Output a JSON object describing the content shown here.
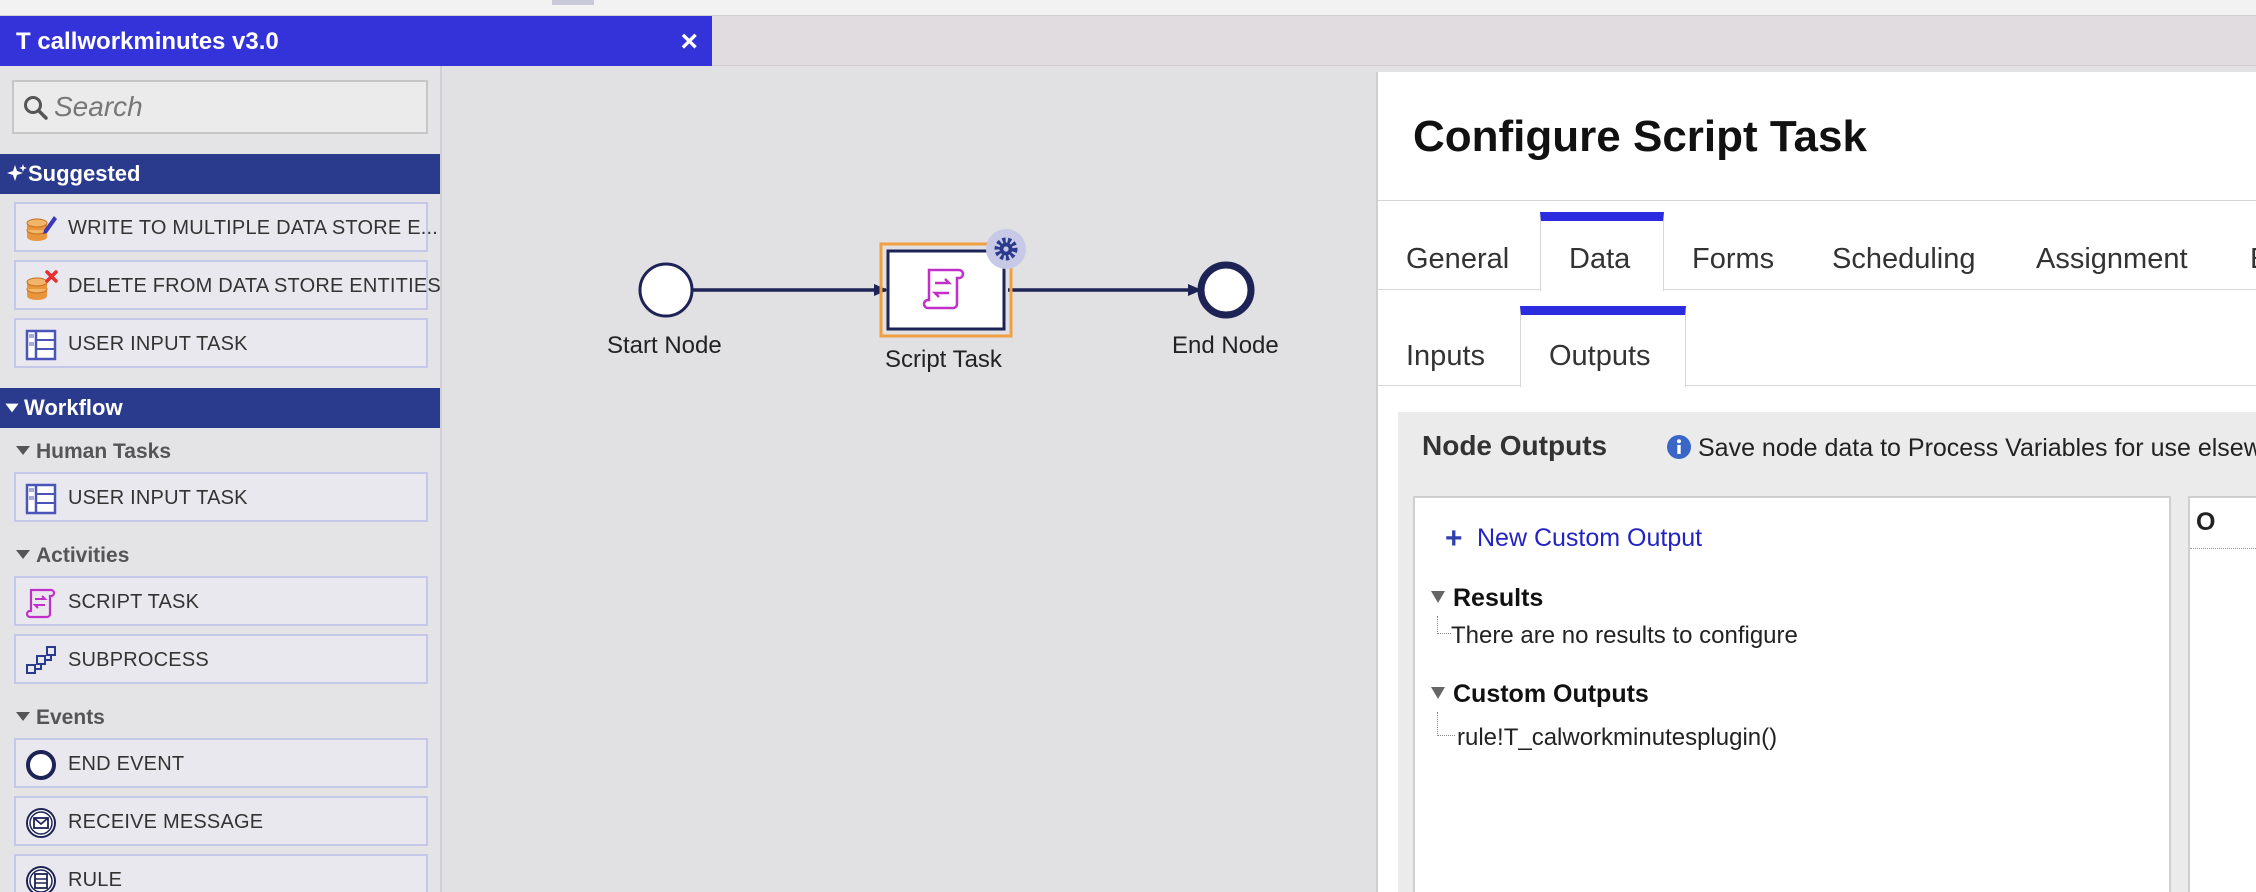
{
  "window": {
    "title": "T callworkminutes v3.0",
    "close_label": "×"
  },
  "palette": {
    "search_placeholder": "Search",
    "suggested": {
      "label": "Suggested",
      "items": [
        {
          "label": "WRITE TO MULTIPLE DATA STORE E...",
          "icon": "write-data-store-icon"
        },
        {
          "label": "DELETE FROM DATA STORE ENTITIES",
          "icon": "delete-data-store-icon"
        },
        {
          "label": "USER INPUT TASK",
          "icon": "user-input-task-icon"
        }
      ]
    },
    "workflow": {
      "label": "Workflow",
      "groups": [
        {
          "label": "Human Tasks",
          "items": [
            {
              "label": "USER INPUT TASK",
              "icon": "user-input-task-icon"
            }
          ]
        },
        {
          "label": "Activities",
          "items": [
            {
              "label": "SCRIPT TASK",
              "icon": "script-task-icon"
            },
            {
              "label": "SUBPROCESS",
              "icon": "subprocess-icon"
            }
          ]
        },
        {
          "label": "Events",
          "items": [
            {
              "label": "END EVENT",
              "icon": "end-event-icon"
            },
            {
              "label": "RECEIVE MESSAGE",
              "icon": "receive-message-icon"
            },
            {
              "label": "RULE",
              "icon": "rule-icon"
            }
          ]
        }
      ]
    }
  },
  "canvas": {
    "nodes": [
      {
        "label": "Start Node",
        "type": "start-event"
      },
      {
        "label": "Script Task",
        "type": "script-task",
        "selected": true
      },
      {
        "label": "End Node",
        "type": "end-event"
      }
    ]
  },
  "config": {
    "title": "Configure Script Task",
    "tabs": [
      "General",
      "Data",
      "Forms",
      "Scheduling",
      "Assignment",
      "E"
    ],
    "active_tab": "Data",
    "subtabs": [
      "Inputs",
      "Outputs"
    ],
    "active_subtab": "Outputs",
    "node_outputs": {
      "heading": "Node Outputs",
      "info": "Save node data to Process Variables for use elsewh",
      "new_custom_output": "New Custom Output",
      "results_label": "Results",
      "results_empty": "There are no results to configure",
      "custom_outputs_label": "Custom Outputs",
      "custom_outputs": [
        "rule!T_calworkminutesplugin()"
      ],
      "right_column_header": "O"
    }
  },
  "colors": {
    "title_bar": "#3333d9",
    "section_header": "#2a3a8c",
    "tab_accent": "#2b2be0",
    "link": "#2323c2",
    "selection_outline": "#f0a040"
  }
}
